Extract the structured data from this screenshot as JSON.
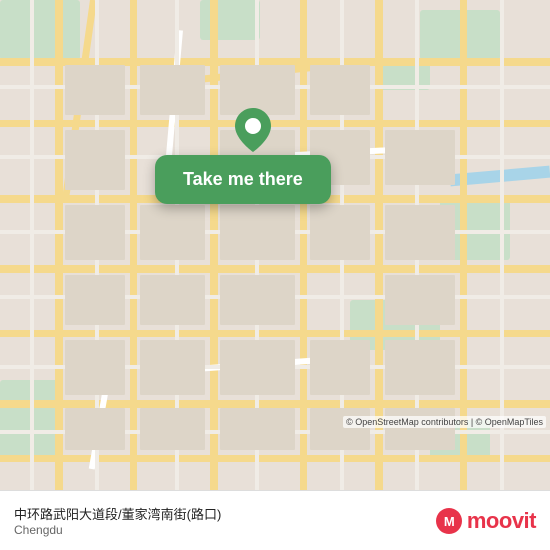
{
  "map": {
    "center_location": "中环路武阳大道段/董家湾南街(路口)",
    "city": "Chengdu",
    "zoom": 14
  },
  "popup": {
    "button_label": "Take me there"
  },
  "attribution": {
    "text": "© OpenStreetMap contributors | © OpenMapTiles"
  },
  "bottom_bar": {
    "location_name": "中环路武阳大道段/董家湾南街(路口)",
    "city": "Chengdu",
    "brand": "moovit"
  },
  "colors": {
    "popup_bg": "#4a9e5c",
    "road_major": "#f5d98c",
    "road_minor": "#ffffff",
    "green": "#c8dfc8",
    "water": "#a8d4e8",
    "brand_red": "#e8334a"
  }
}
